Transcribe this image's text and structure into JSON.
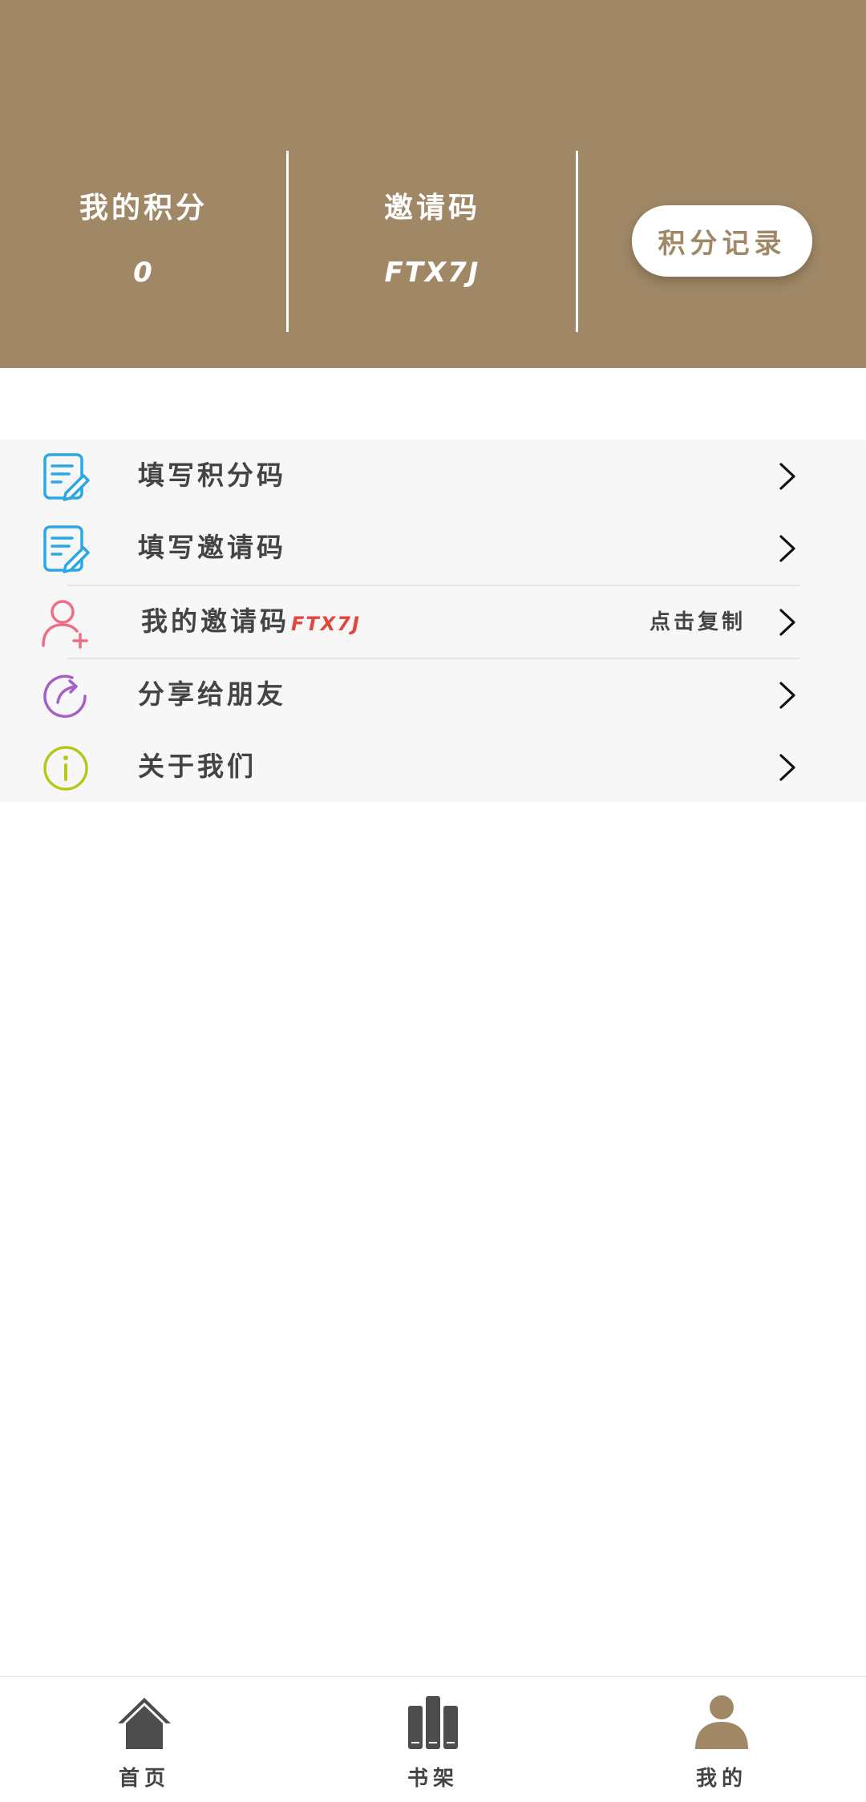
{
  "colors": {
    "accent": "#a08866",
    "menu_bg": "#f7f7f7",
    "code_red": "#e0483f",
    "icon_blue": "#2aa7e4",
    "icon_pink": "#ef6d84",
    "icon_purple": "#a55fc7",
    "icon_lime": "#b6c81e",
    "nav_inactive": "#4d4d4d"
  },
  "header": {
    "points_label": "我的积分",
    "points_value": "0",
    "invite_label": "邀请码",
    "invite_value": "FTX7J",
    "record_button": "积分记录"
  },
  "menu": {
    "items": [
      {
        "label": "填写积分码",
        "icon": "edit-note-icon"
      },
      {
        "label": "填写邀请码",
        "icon": "edit-note-icon"
      },
      {
        "label": "我的邀请码",
        "code": "FTX7J",
        "action": "点击复制",
        "icon": "add-user-icon"
      },
      {
        "label": "分享给朋友",
        "icon": "share-icon"
      },
      {
        "label": "关于我们",
        "icon": "info-icon"
      }
    ]
  },
  "nav": {
    "home": "首页",
    "shelf": "书架",
    "mine": "我的",
    "active": "mine"
  }
}
